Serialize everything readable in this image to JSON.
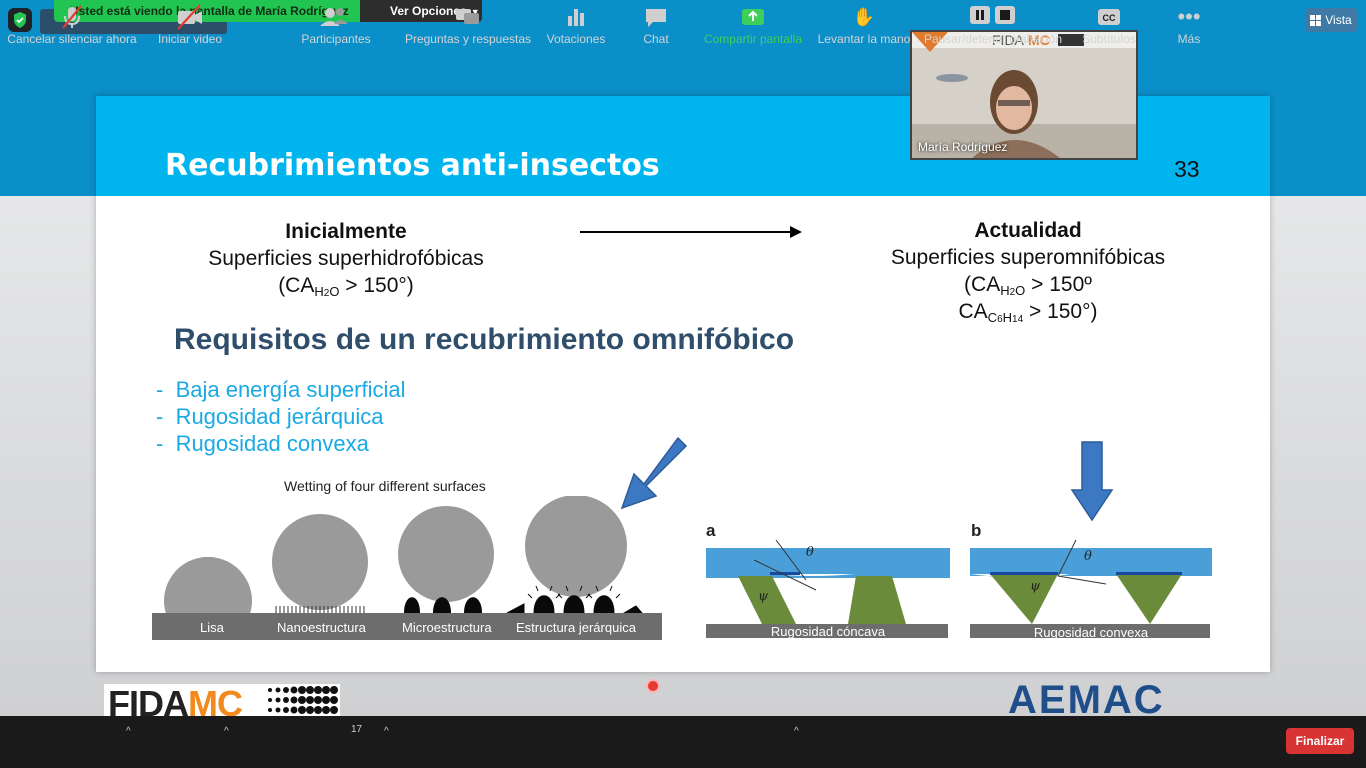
{
  "share_banner": {
    "viewing_text": "Usted está viendo la pantalla de María Rodríguez",
    "options_label": "Ver Opciones"
  },
  "view_button": {
    "label": "Vista"
  },
  "video": {
    "participant_name": "María Rodríguez"
  },
  "slide": {
    "title": "Recubrimientos anti-insectos",
    "number": "33",
    "left": {
      "heading": "Inicialmente",
      "subheading": "Superficies superhidrofóbicas",
      "ca_prefix": "(CA",
      "ca_sub": "H",
      "ca_sub2": "2",
      "ca_sub3": "O",
      "ca_value": " > 150°)"
    },
    "right": {
      "heading": "Actualidad",
      "subheading": "Superficies superomnifóbicas",
      "ca1_prefix": "(CA",
      "ca1_value": " > 150º",
      "ca2_prefix": "CA",
      "ca2_value": " > 150°)"
    },
    "requirements_title": "Requisitos de un recubrimiento omnifóbico",
    "requirements": [
      "Baja energía superficial",
      "Rugosidad jerárquica",
      "Rugosidad convexa"
    ],
    "figure_caption": "Wetting of four different surfaces",
    "surface_labels": [
      "Lisa",
      "Nanoestructura",
      "Microestructura",
      "Estructura jerárquica"
    ],
    "panel_a": {
      "letter": "a",
      "label": "Rugosidad cóncava"
    },
    "panel_b": {
      "letter": "b",
      "label": "Rugosidad convexa"
    },
    "logos": {
      "fida": "FIDA",
      "fida_mc": "MC",
      "aemac": "AEMAC"
    }
  },
  "toolbar": {
    "items": [
      {
        "label": "Cancelar silenciar ahora",
        "icon": "mic-muted-icon"
      },
      {
        "label": "Iniciar video",
        "icon": "video-off-icon"
      },
      {
        "label": "Participantes",
        "icon": "participants-icon",
        "count": "17"
      },
      {
        "label": "Preguntas y respuestas",
        "icon": "qa-icon"
      },
      {
        "label": "Votaciones",
        "icon": "polls-icon"
      },
      {
        "label": "Chat",
        "icon": "chat-icon"
      },
      {
        "label": "Compartir pantalla",
        "icon": "share-screen-icon"
      },
      {
        "label": "Levantar la mano",
        "icon": "raise-hand-icon"
      },
      {
        "label": "Pausar/detener grabación",
        "icon": "pause-stop-icon"
      },
      {
        "label": "Subtítulos",
        "icon": "cc-icon"
      },
      {
        "label": "Más",
        "icon": "more-icon"
      }
    ],
    "end_label": "Finalizar"
  },
  "colors": {
    "slide_header": "#00b5ee",
    "requirements_text": "#1aa9e3",
    "share_banner": "#23c552",
    "end_button": "#d93434"
  }
}
